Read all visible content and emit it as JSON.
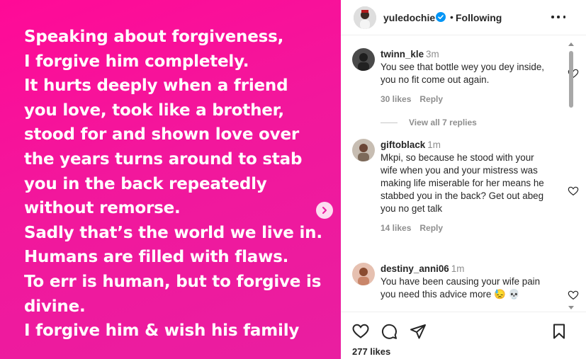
{
  "post": {
    "lines": [
      "Speaking about forgiveness,",
      "I forgive him completely.",
      "It hurts deeply when a friend",
      "you love, took like a brother,",
      "stood for and shown love over",
      "the years turns around to stab",
      "you in the back repeatedly",
      "without remorse.",
      "Sadly that’s the world we live in.",
      "Humans are filled with flaws.",
      "To err is human, but to forgive is",
      "divine.",
      "I forgive him & wish his family"
    ],
    "next_icon": "chevron-right-icon"
  },
  "header": {
    "username": "yuledochie",
    "separator": "•",
    "follow_status": "Following",
    "verified_icon": "verified-badge-icon",
    "more_icon": "more-options-icon"
  },
  "comments": [
    {
      "user": "twinn_kle",
      "time": "3m",
      "text": "You see that bottle wey you dey inside, you no fit come out again.",
      "likes": "30 likes",
      "reply": "Reply"
    },
    {
      "user": "giftoblack",
      "time": "1m",
      "text": "Mkpi, so because he stood with your wife when you and your mistress was making life miserable for her means he stabbed you in the back? Get out abeg you no get talk",
      "likes": "14 likes",
      "reply": "Reply"
    },
    {
      "user": "destiny_anni06",
      "time": "1m",
      "text": "You have been causing your wife pain you need this advice more 😓 💀"
    }
  ],
  "view_replies": "View all 7 replies",
  "actions": {
    "like_icon": "heart-icon",
    "comment_icon": "comment-icon",
    "share_icon": "share-icon",
    "save_icon": "bookmark-icon",
    "likes": "277 likes"
  },
  "colors": {
    "post_bg": "#ff0a97",
    "text": "#262626",
    "muted": "#8e8e8e",
    "verified": "#0095f6"
  }
}
